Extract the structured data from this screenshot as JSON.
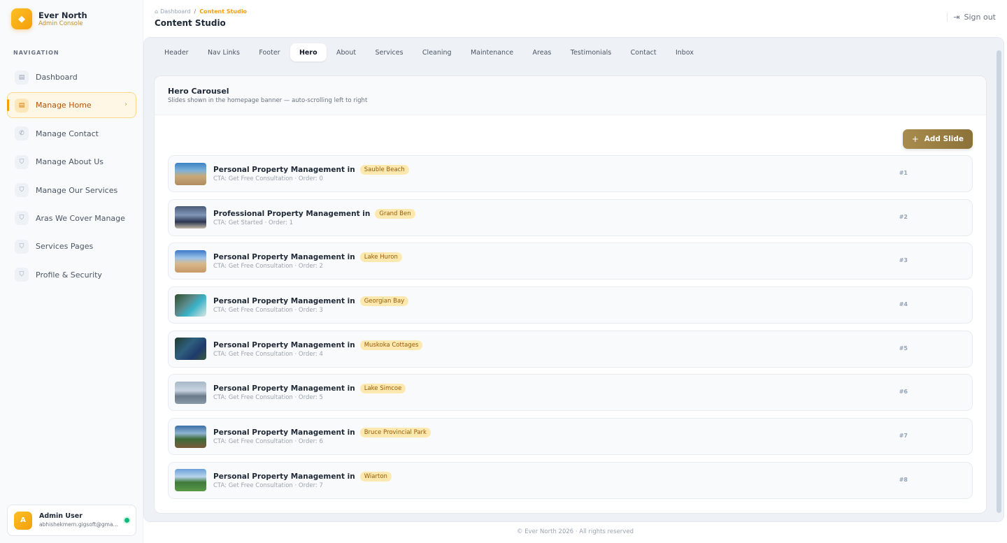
{
  "brand": {
    "name": "Ever North",
    "subtitle": "Admin Console",
    "logo_icon": "gem-icon"
  },
  "sidebar": {
    "heading": "NAVIGATION",
    "items": [
      {
        "label": "Dashboard",
        "icon": "document-icon",
        "active": false
      },
      {
        "label": "Manage Home",
        "icon": "document-icon",
        "active": true
      },
      {
        "label": "Manage Contact",
        "icon": "phone-icon",
        "active": false
      },
      {
        "label": "Manage About Us",
        "icon": "shield-icon",
        "active": false
      },
      {
        "label": "Manage Our Services",
        "icon": "shield-icon",
        "active": false
      },
      {
        "label": "Aras We Cover Manage",
        "icon": "shield-icon",
        "active": false
      },
      {
        "label": "Services Pages",
        "icon": "shield-icon",
        "active": false
      },
      {
        "label": "Profile & Security",
        "icon": "shield-icon",
        "active": false
      }
    ],
    "user": {
      "initial": "A",
      "name": "Admin User",
      "email": "abhishekmern.gigsoft@gmail.com",
      "status_color": "#10b981"
    }
  },
  "header": {
    "breadcrumb": {
      "home": "Dashboard",
      "separator": "/",
      "current": "Content Studio"
    },
    "title": "Content Studio",
    "signout_label": "Sign out"
  },
  "tabs": [
    {
      "label": "Header"
    },
    {
      "label": "Nav Links"
    },
    {
      "label": "Footer"
    },
    {
      "label": "Hero",
      "active": true
    },
    {
      "label": "About"
    },
    {
      "label": "Services"
    },
    {
      "label": "Cleaning"
    },
    {
      "label": "Maintenance"
    },
    {
      "label": "Areas"
    },
    {
      "label": "Testimonials"
    },
    {
      "label": "Contact"
    },
    {
      "label": "Inbox"
    }
  ],
  "hero": {
    "title": "Hero Carousel",
    "subtitle": "Slides shown in the homepage banner — auto-scrolling left to right",
    "add_button": "Add Slide",
    "slides": [
      {
        "title": "Personal Property Management in",
        "location": "Sauble Beach",
        "meta": "CTA: Get Free Consultation · Order: 0",
        "num": "#1"
      },
      {
        "title": "Professional Property Management in",
        "location": "Grand Ben",
        "meta": "CTA: Get Started · Order: 1",
        "num": "#2"
      },
      {
        "title": "Personal Property Management in",
        "location": "Lake Huron",
        "meta": "CTA: Get Free Consultation · Order: 2",
        "num": "#3"
      },
      {
        "title": "Personal Property Management in",
        "location": "Georgian Bay",
        "meta": "CTA: Get Free Consultation · Order: 3",
        "num": "#4"
      },
      {
        "title": "Personal Property Management in",
        "location": "Muskoka Cottages",
        "meta": "CTA: Get Free Consultation · Order: 4",
        "num": "#5"
      },
      {
        "title": "Personal Property Management in",
        "location": "Lake Simcoe",
        "meta": "CTA: Get Free Consultation · Order: 5",
        "num": "#6"
      },
      {
        "title": "Personal Property Management in",
        "location": "Bruce Provincial Park",
        "meta": "CTA: Get Free Consultation · Order: 6",
        "num": "#7"
      },
      {
        "title": "Personal Property Management in",
        "location": "Wiarton",
        "meta": "CTA: Get Free Consultation · Order: 7",
        "num": "#8"
      }
    ]
  },
  "footer": {
    "text": "© Ever North 2026 · All rights reserved"
  },
  "colors": {
    "accent": "#f59e0b",
    "button": "#9a7f44",
    "badge_bg": "#fde9b0"
  }
}
